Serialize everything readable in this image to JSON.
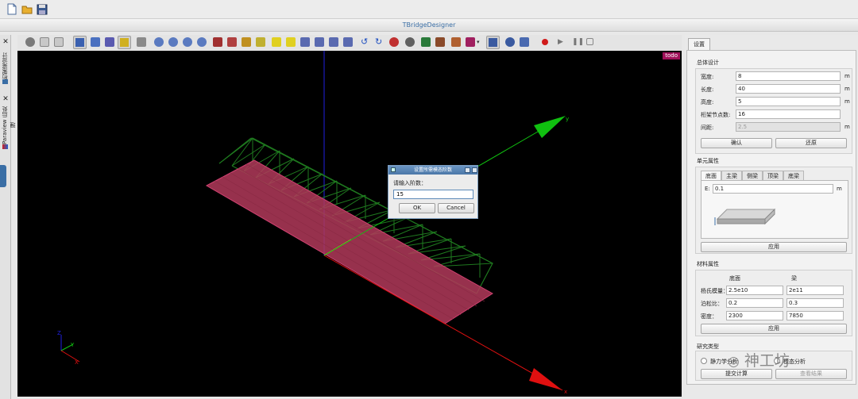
{
  "app": {
    "window_title": "TBridgeDesigner"
  },
  "menubar": {
    "icons": [
      "new-file-icon",
      "open-folder-icon",
      "save-disk-icon"
    ]
  },
  "left_dock": {
    "tabs": [
      {
        "label": "桁架梁设计",
        "icon": "bridge-icon"
      },
      {
        "label": "Paraview 后处理",
        "icon": "paraview-icon"
      }
    ]
  },
  "viewport": {
    "badge": "todo",
    "axes": {
      "x": "x",
      "y": "y"
    },
    "colors": {
      "background": "#000000",
      "truss": "#1f7a1f",
      "deck": "#b23a5a",
      "x_axis": "#e01010",
      "y_axis": "#10c010",
      "z_axis": "#2020e0"
    }
  },
  "dialog": {
    "title": "设置所需模态阶数",
    "prompt": "请输入阶数：",
    "value": "15",
    "ok": "OK",
    "cancel": "Cancel"
  },
  "panel": {
    "tab": "设置",
    "overall": {
      "title": "总体设计",
      "width_label": "宽度:",
      "width_value": "8",
      "width_unit": "m",
      "length_label": "长度:",
      "length_value": "40",
      "length_unit": "m",
      "height_label": "高度:",
      "height_value": "5",
      "height_unit": "m",
      "nodes_label": "桁架节点数:",
      "nodes_value": "16",
      "spacing_label": "间距:",
      "spacing_value": "2.5",
      "spacing_unit": "m",
      "confirm": "确认",
      "restore": "还原"
    },
    "element": {
      "title": "单元属性",
      "tabs": [
        "底面",
        "主梁",
        "侧梁",
        "顶梁",
        "底梁"
      ],
      "e_label": "E:",
      "e_value": "0.1",
      "e_unit": "m",
      "apply": "应用"
    },
    "material": {
      "title": "材料属性",
      "col_bottom": "底面",
      "col_beam": "梁",
      "youngs_label": "杨氏模量：",
      "youngs_bottom": "2.5e10",
      "youngs_beam": "2e11",
      "poisson_label": "泊松比：",
      "poisson_bottom": "0.2",
      "poisson_beam": "0.3",
      "density_label": "密度：",
      "density_bottom": "2300",
      "density_beam": "7850",
      "apply": "应用"
    },
    "study": {
      "title": "研究类型",
      "statics": "静力学分析",
      "modal": "模态分析",
      "submit": "提交计算",
      "view_result": "查看结果"
    }
  },
  "watermark": "神工坊"
}
